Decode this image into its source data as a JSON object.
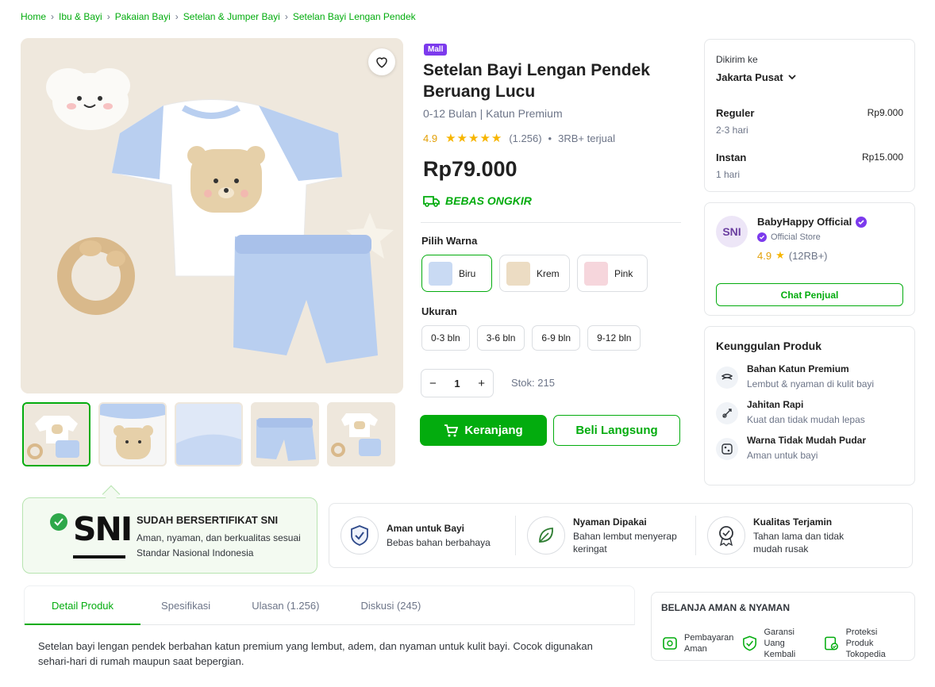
{
  "breadcrumb": [
    "Home",
    "Ibu & Bayi",
    "Pakaian Bayi",
    "Setelan & Jumper Bayi",
    "Setelan Bayi Lengan Pendek"
  ],
  "product": {
    "badge": "Mall",
    "title": "Setelan Bayi Lengan Pendek Beruang Lucu",
    "subtitle": "0-12 Bulan | Katun Premium",
    "rating": "4.9",
    "rating_count": "(1.256)",
    "sold": "3RB+ terjual",
    "price": "Rp79.000",
    "free_shipping": "BEBAS ONGKIR",
    "color_label": "Pilih Warna",
    "colors": [
      {
        "name": "Biru",
        "swatch": "#b9cff0"
      },
      {
        "name": "Krem",
        "swatch": "#e8d3b4"
      },
      {
        "name": "Pink",
        "swatch": "#f4c9d2"
      }
    ],
    "selected_color": "Biru",
    "size_label": "Ukuran",
    "sizes": [
      "0-3 bln",
      "3-6 bln",
      "6-9 bln",
      "9-12 bln"
    ],
    "quantity": "1",
    "qty_minus": "−",
    "qty_plus": "+",
    "stock": "Stok: 215",
    "cart_button": "Keranjang",
    "buy_button": "Beli Langsung",
    "thumbnail_count": 5
  },
  "shipping": {
    "to_label": "Dikirim ke",
    "location": "Jakarta Pusat",
    "options": [
      {
        "name": "Reguler",
        "eta": "2-3 hari",
        "price": "Rp9.000"
      },
      {
        "name": "Instan",
        "eta": "1 hari",
        "price": "Rp15.000"
      }
    ]
  },
  "seller": {
    "logo": "SNI",
    "name": "BabyHappy Official",
    "type": "Official Store",
    "rating": "4.9",
    "rating_count": "(12RB+)",
    "chat_button": "Chat Penjual"
  },
  "advantages": {
    "title": "Keunggulan Produk",
    "items": [
      {
        "title": "Bahan Katun Premium",
        "desc": "Lembut & nyaman di kulit bayi"
      },
      {
        "title": "Jahitan Rapi",
        "desc": "Kuat dan tidak mudah lepas"
      },
      {
        "title": "Warna Tidak Mudah Pudar",
        "desc": "Aman untuk bayi"
      }
    ]
  },
  "sni": {
    "logo": "SNI",
    "title": "SUDAH BERSERTIFIKAT SNI",
    "desc": "Aman, nyaman, dan berkualitas sesuai Standar Nasional Indonesia"
  },
  "features": [
    {
      "title": "Aman untuk Bayi",
      "desc": "Bebas bahan berbahaya",
      "icon": "shield-check-icon"
    },
    {
      "title": "Nyaman Dipakai",
      "desc": "Bahan lembut menyerap keringat",
      "icon": "leaf-icon"
    },
    {
      "title": "Kualitas Terjamin",
      "desc": "Tahan lama dan tidak mudah rusak",
      "icon": "award-icon"
    }
  ],
  "tabs": [
    "Detail Produk",
    "Spesifikasi",
    "Ulasan (1.256)",
    "Diskusi (245)"
  ],
  "active_tab": "Detail Produk",
  "description": "Setelan bayi lengan pendek berbahan katun premium yang lembut, adem, dan nyaman untuk kulit bayi. Cocok digunakan sehari-hari di rumah maupun saat bepergian.",
  "safe_shopping": {
    "title": "BELANJA AMAN & NYAMAN",
    "items": [
      {
        "line1": "Pembayaran",
        "line2": "Aman"
      },
      {
        "line1": "Garansi Uang",
        "line2": "Kembali"
      },
      {
        "line1": "Proteksi Produk",
        "line2": "Tokopedia"
      }
    ]
  },
  "colors": {
    "accent": "#03ac0e",
    "mall": "#7c3aed",
    "star": "#f7b500"
  }
}
